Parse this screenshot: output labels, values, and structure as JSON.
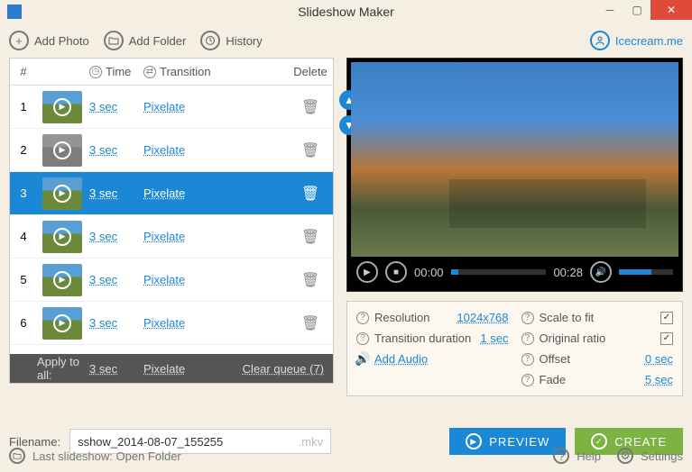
{
  "app": {
    "title": "Slideshow Maker"
  },
  "toolbar": {
    "add_photo": "Add Photo",
    "add_folder": "Add Folder",
    "history": "History",
    "brand": "Icecream.me"
  },
  "columns": {
    "num": "#",
    "time": "Time",
    "transition": "Transition",
    "delete": "Delete"
  },
  "rows": [
    {
      "num": "1",
      "time": "3 sec",
      "transition": "Pixelate",
      "selected": false,
      "gray": false
    },
    {
      "num": "2",
      "time": "3 sec",
      "transition": "Pixelate",
      "selected": false,
      "gray": true
    },
    {
      "num": "3",
      "time": "3 sec",
      "transition": "Pixelate",
      "selected": true,
      "gray": false
    },
    {
      "num": "4",
      "time": "3 sec",
      "transition": "Pixelate",
      "selected": false,
      "gray": false
    },
    {
      "num": "5",
      "time": "3 sec",
      "transition": "Pixelate",
      "selected": false,
      "gray": false
    },
    {
      "num": "6",
      "time": "3 sec",
      "transition": "Pixelate",
      "selected": false,
      "gray": false
    }
  ],
  "footer_row": {
    "label": "Apply to all:",
    "time": "3 sec",
    "transition": "Pixelate",
    "clear": "Clear queue  (7)"
  },
  "player": {
    "cur": "00:00",
    "dur": "00:28"
  },
  "settings": {
    "resolution_lbl": "Resolution",
    "resolution_val": "1024x768",
    "trans_dur_lbl": "Transition duration",
    "trans_dur_val": "1 sec",
    "add_audio": "Add Audio",
    "scale_lbl": "Scale to fit",
    "scale_chk": true,
    "ratio_lbl": "Original ratio",
    "ratio_chk": true,
    "offset_lbl": "Offset",
    "offset_val": "0 sec",
    "fade_lbl": "Fade",
    "fade_val": "5 sec"
  },
  "filename": {
    "label": "Filename:",
    "value": "sshow_2014-08-07_155255",
    "ext": ".mkv"
  },
  "buttons": {
    "preview": "PREVIEW",
    "create": "CREATE"
  },
  "status": {
    "last": "Last slideshow: Open Folder",
    "help": "Help",
    "settings": "Settings"
  }
}
